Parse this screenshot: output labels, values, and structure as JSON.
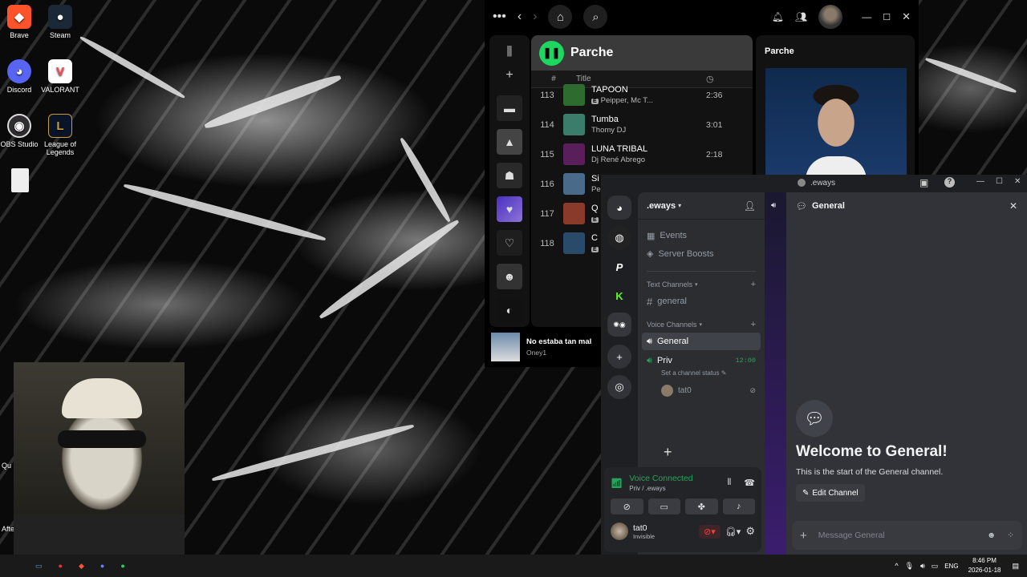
{
  "desktop": {
    "icons": [
      {
        "label": "Brave",
        "glyph": "🦁",
        "color": "#fb542b"
      },
      {
        "label": "Steam",
        "glyph": "♨",
        "color": "#1b2838"
      },
      {
        "label": "Discord",
        "glyph": "◕",
        "color": "#5865f2"
      },
      {
        "label": "VALORANT",
        "glyph": "V",
        "color": "#ff4655"
      },
      {
        "label": "OBS Studio",
        "glyph": "◉",
        "color": "#302e31"
      },
      {
        "label": "League of\nLegends",
        "glyph": "L",
        "color": "#c89b3c"
      }
    ],
    "partial_labels": [
      "Qu",
      "Afte"
    ]
  },
  "spotify": {
    "playlist_title": "Parche",
    "col_num": "#",
    "col_title": "Title",
    "right_panel_title": "Parche",
    "tracks": [
      {
        "n": "113",
        "title": "TAPOON",
        "artist": "Peipper, Mc T...",
        "explicit": true,
        "dur": "2:36",
        "color": "#2e6b2e"
      },
      {
        "n": "114",
        "title": "Tumba",
        "artist": "Thomy DJ",
        "explicit": false,
        "dur": "3:01",
        "color": "#3a7d6b"
      },
      {
        "n": "115",
        "title": "LUNA TRIBAL",
        "artist": "Dj René Abrego",
        "explicit": false,
        "dur": "2:18",
        "color": "#5a1f5a"
      },
      {
        "n": "116",
        "title": "Si",
        "artist": "Pe",
        "explicit": false,
        "dur": "",
        "color": "#4a6a8a"
      },
      {
        "n": "117",
        "title": "Q",
        "artist": "",
        "explicit": true,
        "dur": "",
        "color": "#8a3a2a"
      },
      {
        "n": "118",
        "title": "C",
        "artist": "",
        "explicit": true,
        "dur": "",
        "color": "#2a4a6a"
      }
    ],
    "now_playing": {
      "title": "No estaba tan mal",
      "artist": "Oney1"
    }
  },
  "discord": {
    "window_title": ".eways",
    "server_name": ".eways",
    "events": "Events",
    "boosts": "Server Boosts",
    "text_channels": "Text Channels",
    "general_text": "general",
    "voice_channels": "Voice Channels",
    "voice_general": "General",
    "voice_priv": "Priv",
    "priv_time": "12:00",
    "channel_status": "Set a channel status",
    "member": "tat0",
    "header_channel": "General",
    "welcome_title": "Welcome to General!",
    "welcome_sub": "This is the start of the General channel.",
    "edit_channel": "Edit Channel",
    "message_placeholder": "Message General",
    "voice_connected": "Voice Connected",
    "voice_path": "Priv / .eways",
    "user_name": "tat0",
    "user_status": "Invisible"
  },
  "taskbar": {
    "lang": "ENG",
    "time": "8:46 PM",
    "date": "2026-01-18"
  }
}
